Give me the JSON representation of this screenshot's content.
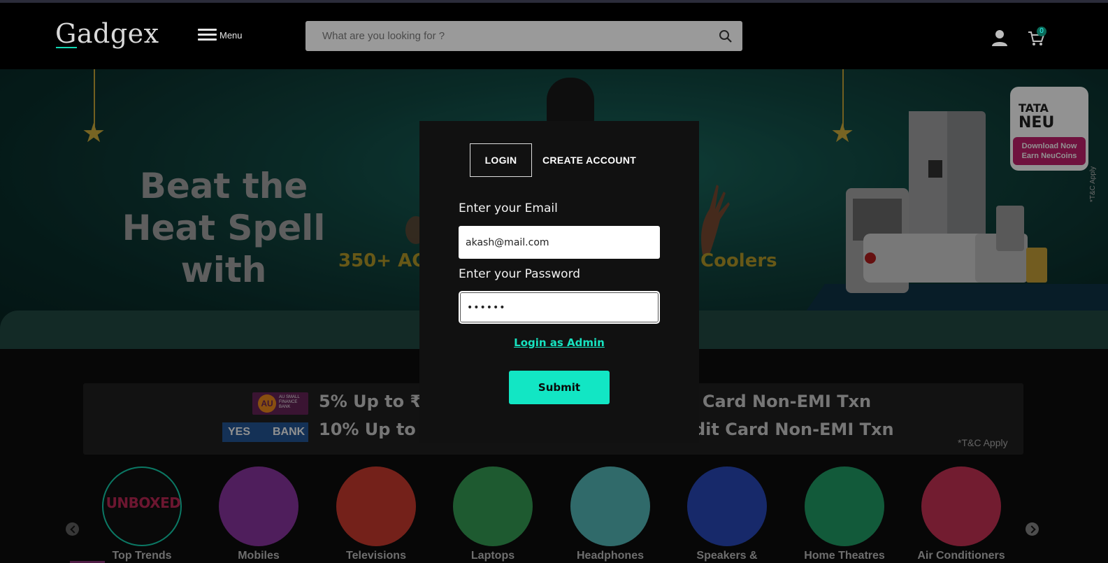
{
  "header": {
    "logo": "Gadgex",
    "menu_label": "Menu",
    "search_placeholder": "What are you looking for ?",
    "cart_count": "0"
  },
  "hero": {
    "title_line1": "Beat the",
    "title_line2": "Heat Spell with",
    "strip_text_left": "350+ ACs",
    "strip_text_right": "Coolers",
    "promo_brand_line1": "TATA",
    "promo_brand_line2": "NEU",
    "promo_cta_line1": "Download Now",
    "promo_cta_line2": "Earn NeuCoins",
    "tc_vertical": "*T&C Apply"
  },
  "offer": {
    "au_logo": "AU",
    "au_small": "AU SMALL FINANCE BANK",
    "yes_left": "YES",
    "yes_right": "BANK",
    "line1_left": "5% Up to ₹1",
    "line1_right": "t Card Non-EMI Txn",
    "line2_left": "10% Up to ₹",
    "line2_right": "dit Card Non-EMI Txn",
    "tc": "*T&C Apply"
  },
  "categories": [
    {
      "label": "Top Trends",
      "art": "UNBOXED",
      "color": "#0e0e0e"
    },
    {
      "label": "Mobiles",
      "color": "#7a2f8e"
    },
    {
      "label": "Televisions",
      "color": "#b23328"
    },
    {
      "label": "Laptops",
      "color": "#2f8a4a"
    },
    {
      "label": "Headphones",
      "color": "#4aa3a3"
    },
    {
      "label": "Speakers &",
      "color": "#2440a4"
    },
    {
      "label": "Home Theatres",
      "color": "#1c8a5a"
    },
    {
      "label": "Air Conditioners",
      "color": "#b02c4a"
    }
  ],
  "modal": {
    "tab_login": "LOGIN",
    "tab_create": "CREATE ACCOUNT",
    "email_label": "Enter your Email",
    "email_value": "akash@mail.com",
    "password_label": "Enter your Password",
    "password_value": "••••••",
    "admin_link": "Login as Admin",
    "submit": "Submit"
  },
  "colors": {
    "accent": "#12e6c4",
    "background": "#000000",
    "modal_bg": "#111111"
  }
}
